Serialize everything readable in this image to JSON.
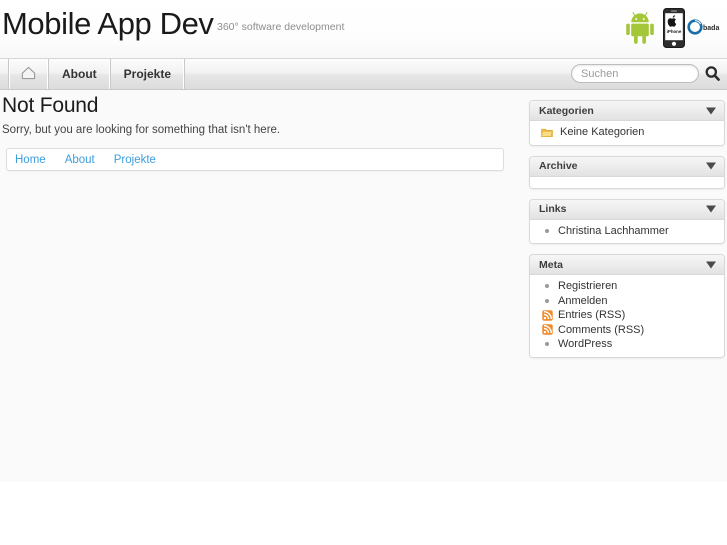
{
  "site": {
    "title": "Mobile App Dev",
    "tagline": "360° software development",
    "logos": [
      {
        "name": "android-logo",
        "label": "Android"
      },
      {
        "name": "iphone-logo",
        "label": "iPhone"
      },
      {
        "name": "bada-logo",
        "label": "bada"
      }
    ],
    "accent_link_color": "#3d9ede",
    "android_green": "#a4c639",
    "bada_blue": "#1a6fa8",
    "rss_orange": "#f18a2b"
  },
  "nav": {
    "home_icon": "home-icon",
    "items": [
      {
        "label": "About"
      },
      {
        "label": "Projekte"
      }
    ]
  },
  "search": {
    "placeholder": "Suchen",
    "value": "",
    "icon": "search-icon"
  },
  "main": {
    "title": "Not Found",
    "message": "Sorry, but you are looking for something that isn't here.",
    "links": [
      {
        "label": "Home"
      },
      {
        "label": "About"
      },
      {
        "label": "Projekte"
      }
    ]
  },
  "sidebar": {
    "widgets": [
      {
        "title": "Kategorien",
        "toggle_icon": "chevron-down-icon",
        "items": [
          {
            "label": "Keine Kategorien",
            "icon": "folder-icon"
          }
        ]
      },
      {
        "title": "Archive",
        "toggle_icon": "chevron-down-icon",
        "items": []
      },
      {
        "title": "Links",
        "toggle_icon": "chevron-down-icon",
        "items": [
          {
            "label": "Christina Lachhammer",
            "icon": "bullet"
          }
        ]
      },
      {
        "title": "Meta",
        "toggle_icon": "chevron-down-icon",
        "items": [
          {
            "label": "Registrieren",
            "icon": "bullet"
          },
          {
            "label": "Anmelden",
            "icon": "bullet"
          },
          {
            "label": "Entries (RSS)",
            "icon": "rss-icon"
          },
          {
            "label": "Comments (RSS)",
            "icon": "rss-icon"
          },
          {
            "label": "WordPress",
            "icon": "bullet"
          }
        ]
      }
    ]
  }
}
